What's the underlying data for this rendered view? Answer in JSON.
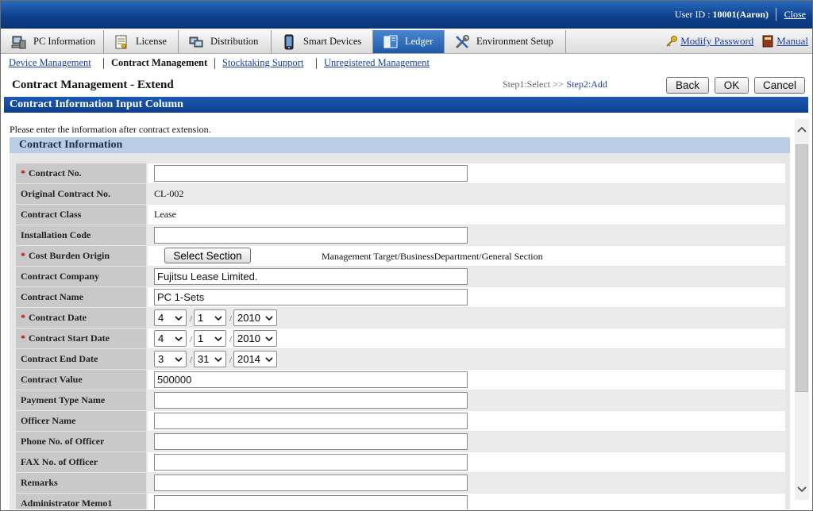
{
  "header": {
    "user_prefix": "User ID : ",
    "user_value": "10001(Aaron)",
    "close_label": "Close"
  },
  "tabs": [
    {
      "label": "PC Information",
      "icon": "pc-icon",
      "active": false
    },
    {
      "label": "License",
      "icon": "license-icon",
      "active": false
    },
    {
      "label": "Distribution",
      "icon": "distribution-icon",
      "active": false
    },
    {
      "label": "Smart Devices",
      "icon": "smartphone-icon",
      "active": false
    },
    {
      "label": "Ledger",
      "icon": "ledger-book-icon",
      "active": true
    },
    {
      "label": "Environment Setup",
      "icon": "tools-icon",
      "active": false
    }
  ],
  "toplinks": {
    "modify_password": "Modify Password",
    "manual": "Manual"
  },
  "subnav": {
    "device_management": "Device Management",
    "contract_management": "Contract Management",
    "stocktaking_support": "Stocktaking Support",
    "unregistered_management": "Unregistered Management"
  },
  "page": {
    "title": "Contract Management - Extend",
    "step1": "Step1:Select >>",
    "step2": "Step2:Add",
    "back_label": "Back",
    "ok_label": "OK",
    "cancel_label": "Cancel"
  },
  "section": {
    "title": "Contract Information Input Column",
    "notice": "Please enter the information after contract extension.",
    "panel_title": "Contract Information"
  },
  "form": {
    "required_mark": "*",
    "contract_no": {
      "label": "Contract No.",
      "value": ""
    },
    "original_contract_no": {
      "label": "Original Contract No.",
      "value": "CL-002"
    },
    "contract_class": {
      "label": "Contract Class",
      "value": "Lease"
    },
    "installation_code": {
      "label": "Installation Code",
      "value": ""
    },
    "cost_burden_origin": {
      "label": "Cost Burden Origin",
      "button": "Select Section",
      "path": "Management Target/BusinessDepartment/General Section"
    },
    "contract_company": {
      "label": "Contract Company",
      "value": "Fujitsu Lease Limited."
    },
    "contract_name": {
      "label": "Contract Name",
      "value": "PC 1-Sets"
    },
    "contract_date": {
      "label": "Contract Date",
      "month": "4",
      "day": "1",
      "year": "2010"
    },
    "contract_start_date": {
      "label": "Contract Start Date",
      "month": "4",
      "day": "1",
      "year": "2010"
    },
    "contract_end_date": {
      "label": "Contract End Date",
      "month": "3",
      "day": "31",
      "year": "2014"
    },
    "contract_value": {
      "label": "Contract Value",
      "value": "500000"
    },
    "payment_type_name": {
      "label": "Payment Type Name",
      "value": ""
    },
    "officer_name": {
      "label": "Officer Name",
      "value": ""
    },
    "phone_no_of_officer": {
      "label": "Phone No. of Officer",
      "value": ""
    },
    "fax_no_of_officer": {
      "label": "FAX No. of Officer",
      "value": ""
    },
    "remarks": {
      "label": "Remarks",
      "value": ""
    },
    "administrator_memo": {
      "label": "Administrator Memo1",
      "value": ""
    },
    "date_separator": "/"
  }
}
